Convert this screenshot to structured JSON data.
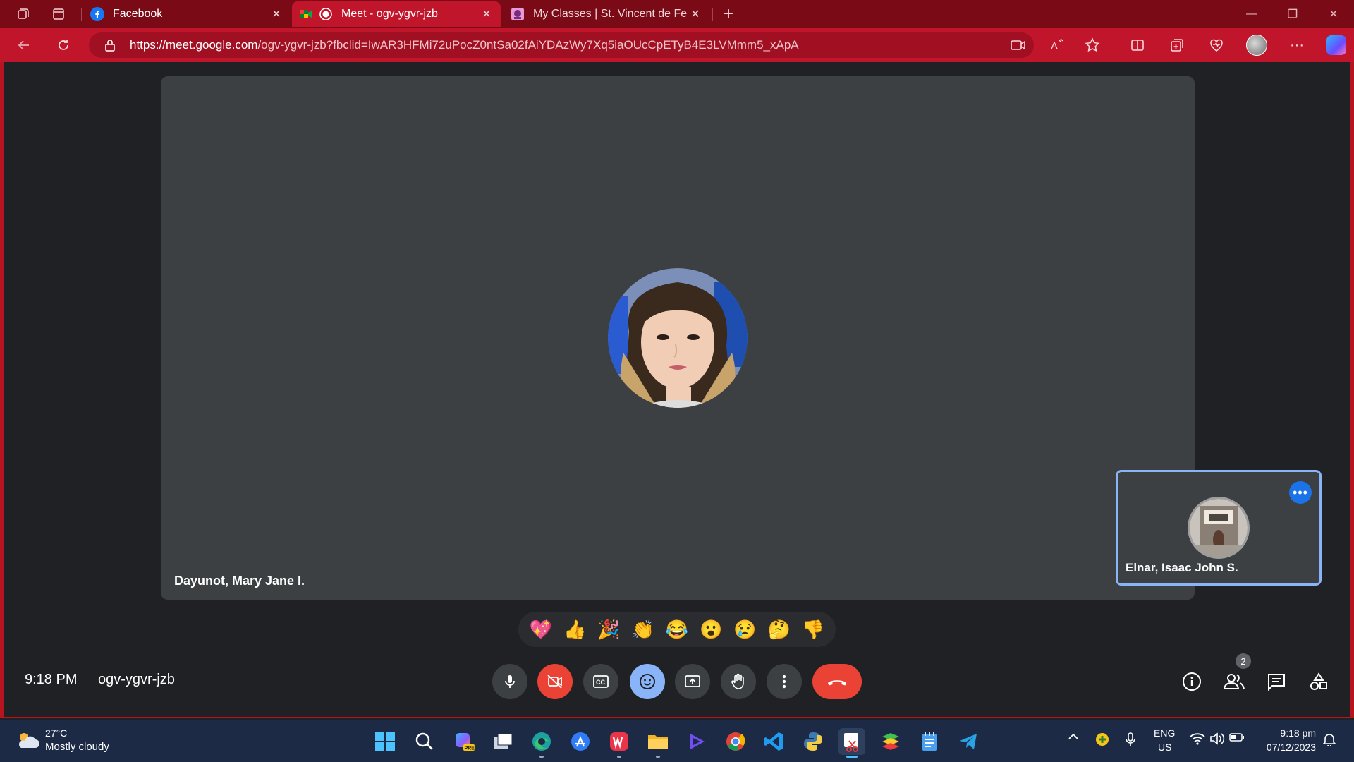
{
  "browser": {
    "tabs": [
      {
        "label": "Facebook",
        "active": false
      },
      {
        "label": "Meet - ogv-ygvr-jzb",
        "active": true
      },
      {
        "label": "My Classes | St. Vincent de Ferrer",
        "active": false
      }
    ],
    "url_host": "https://meet.google.com",
    "url_path": "/ogv-ygvr-jzb?fbclid=IwAR3HFMi72uPocZ0ntSa02fAiYDAzWy7Xq5iaOUcCpETyB4E3LVMmm5_xApA",
    "accent_color": "#c0152a"
  },
  "meet": {
    "main_participant": "Dayunot, Mary Jane I.",
    "self_participant": "Elnar, Isaac John S.",
    "reactions": [
      "💖",
      "👍",
      "🎉",
      "👏",
      "😂",
      "😮",
      "😢",
      "🤔",
      "👎"
    ],
    "time": "9:18 PM",
    "meeting_code": "ogv-ygvr-jzb",
    "participant_count": "2",
    "controls": [
      "microphone",
      "camera-off",
      "captions",
      "emoji",
      "present",
      "raise-hand",
      "more-options",
      "end-call"
    ],
    "side_controls": [
      "info",
      "people",
      "chat",
      "activities"
    ]
  },
  "taskbar": {
    "weather_temp": "27°C",
    "weather_desc": "Mostly cloudy",
    "lang": "ENG",
    "region": "US",
    "time": "9:18 pm",
    "date": "07/12/2023"
  }
}
